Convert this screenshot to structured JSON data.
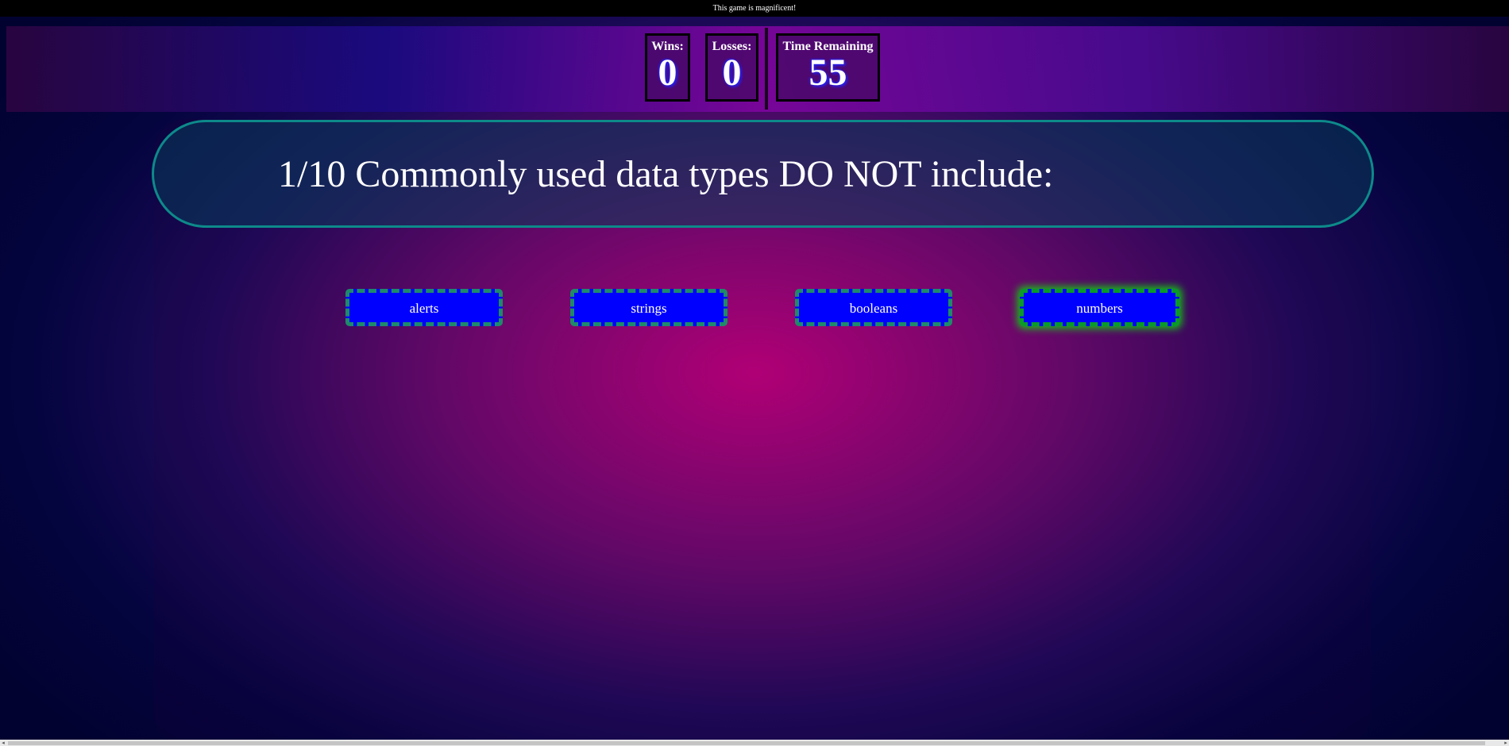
{
  "banner": {
    "text": "This game is magnificent!"
  },
  "scoreboard": {
    "wins_label": "Wins:",
    "wins_value": "0",
    "losses_label": "Losses:",
    "losses_value": "0",
    "time_label": "Time Remaining",
    "time_value": "55"
  },
  "question": {
    "text": "1/10 Commonly used data types DO NOT include:"
  },
  "answers": [
    {
      "label": "alerts"
    },
    {
      "label": "strings"
    },
    {
      "label": "booleans"
    },
    {
      "label": "numbers"
    }
  ],
  "scrollbar": {
    "left_icon": "scroll-left-arrow-icon",
    "right_icon": "scroll-right-arrow-icon"
  },
  "colors": {
    "button_bg": "#0000ff",
    "button_border": "#1e8a6a",
    "question_border": "#0d8a8a",
    "highlight_glow": "#14c414"
  }
}
